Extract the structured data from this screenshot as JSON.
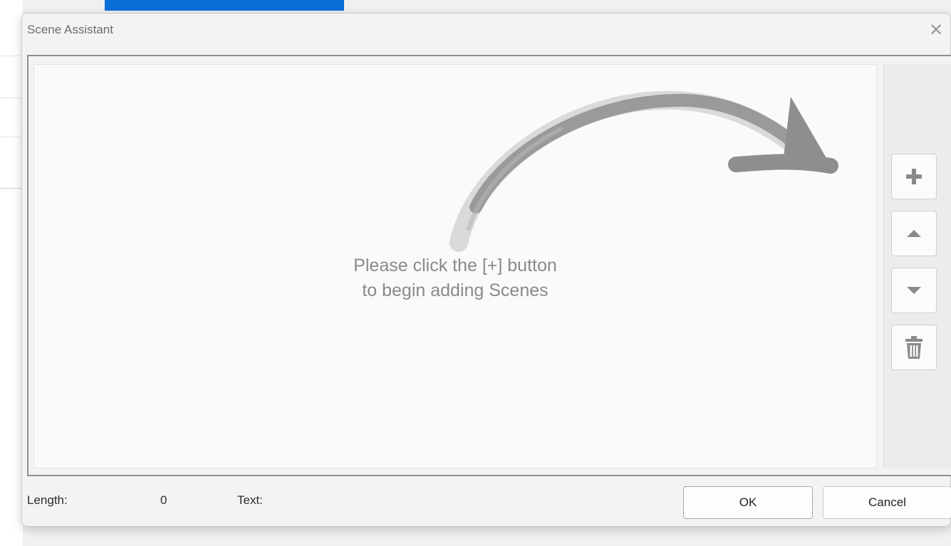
{
  "dialog": {
    "title": "Scene Assistant",
    "close_icon": "close-icon"
  },
  "scene_list": {
    "hint_line1": "Please click the [+] button",
    "hint_line2": "to begin adding Scenes",
    "arrow_icon": "curved-arrow-right-icon"
  },
  "side_panel": {
    "add_icon": "plus-icon",
    "up_icon": "triangle-up-icon",
    "down_icon": "triangle-down-icon",
    "delete_icon": "trash-icon"
  },
  "footer": {
    "length_label": "Length:",
    "length_value": "0",
    "text_label": "Text:",
    "ok_label": "OK",
    "cancel_label": "Cancel"
  },
  "colors": {
    "accent": "#0a6fd8",
    "icon_gray": "#8a8a8a"
  }
}
